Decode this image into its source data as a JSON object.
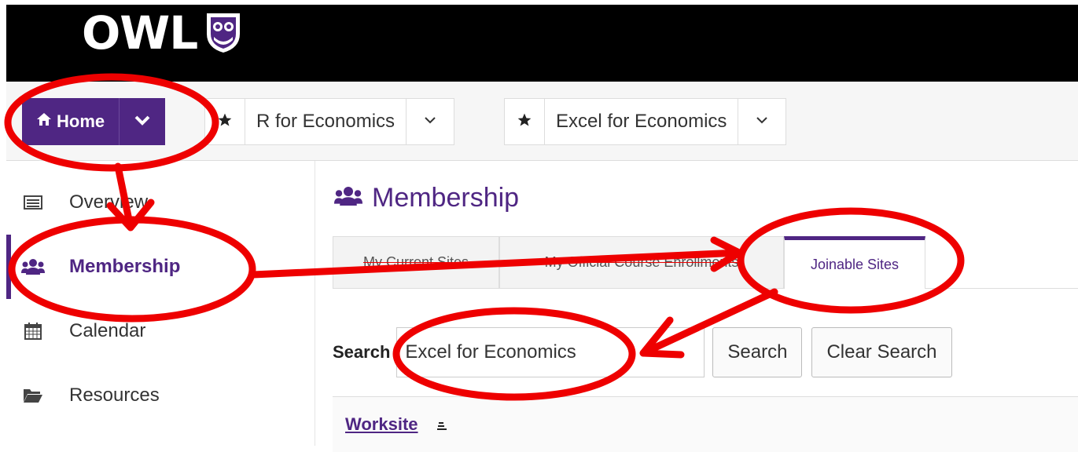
{
  "header": {
    "logo_text": "OWL",
    "logo_icon": "owl-shield-icon",
    "brand_color": "#4f2683"
  },
  "site_nav": {
    "home": {
      "label": "Home",
      "icon": "home-icon"
    },
    "favorites": [
      {
        "title": "R for Economics",
        "icon": "star-icon"
      },
      {
        "title": "Excel for Economics",
        "icon": "star-icon"
      }
    ]
  },
  "tool_menu": {
    "items": [
      {
        "label": "Overview",
        "icon": "overview-icon",
        "active": false
      },
      {
        "label": "Membership",
        "icon": "users-icon",
        "active": true
      },
      {
        "label": "Calendar",
        "icon": "calendar-icon",
        "active": false
      },
      {
        "label": "Resources",
        "icon": "folder-icon",
        "active": false
      }
    ]
  },
  "main": {
    "title": "Membership",
    "title_icon": "users-icon",
    "tabs": [
      {
        "label": "My Current Sites",
        "active": false
      },
      {
        "label": "My Official Course Enrollments",
        "active": false
      },
      {
        "label": "Joinable Sites",
        "active": true
      }
    ],
    "search": {
      "label": "Search",
      "value": "Excel for Economics",
      "search_button": "Search",
      "clear_button": "Clear Search"
    },
    "results": {
      "column_header": "Worksite",
      "sort_icon": "sort-icon"
    }
  },
  "annotation_color": "#ee0000"
}
